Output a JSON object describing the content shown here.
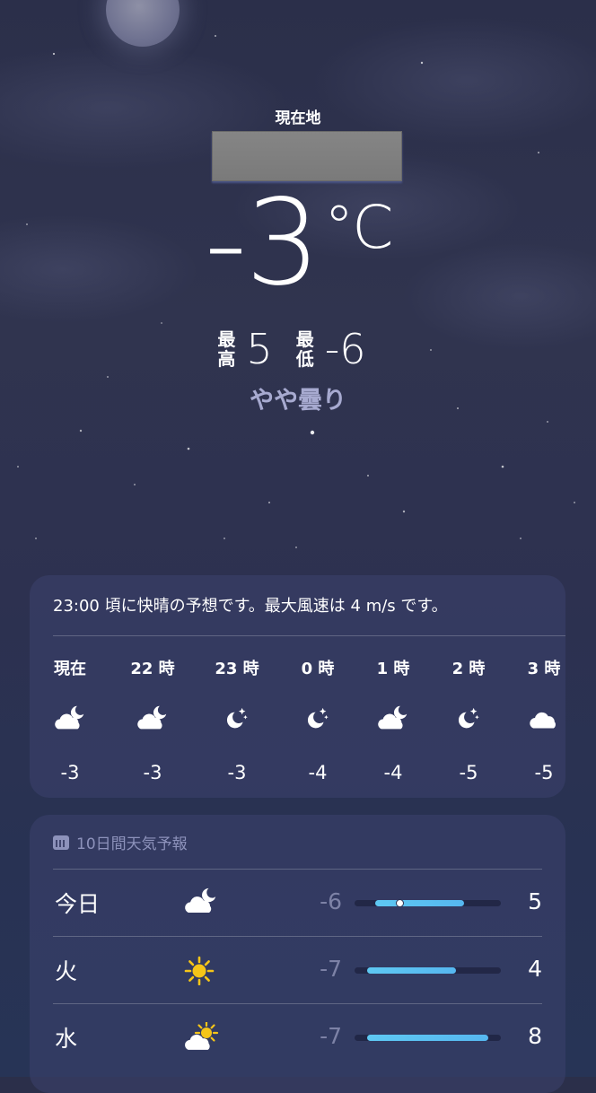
{
  "header": {
    "location_label": "現在地",
    "temperature": "-3",
    "temperature_unit": "°C",
    "high_label": "最高",
    "high_value": "5",
    "low_label": "最低",
    "low_value": "-6",
    "condition": "やや曇り"
  },
  "hourly": {
    "summary": "23:00 頃に快晴の予想です。最大風速は 4 m/s です。",
    "items": [
      {
        "time": "現在",
        "icon": "partly-cloudy-night-icon",
        "temp": "-3"
      },
      {
        "time": "22 時",
        "icon": "partly-cloudy-night-icon",
        "temp": "-3"
      },
      {
        "time": "23 時",
        "icon": "clear-night-icon",
        "temp": "-3"
      },
      {
        "time": "0 時",
        "icon": "clear-night-icon",
        "temp": "-4"
      },
      {
        "time": "1 時",
        "icon": "partly-cloudy-night-icon",
        "temp": "-4"
      },
      {
        "time": "2 時",
        "icon": "clear-night-icon",
        "temp": "-5"
      },
      {
        "time": "3 時",
        "icon": "cloud-icon",
        "temp": "-5"
      }
    ]
  },
  "daily": {
    "header_label": "10日間天気予報",
    "header_icon": "calendar-icon",
    "bar_gradient": [
      "#5ec8f2",
      "#56b7f0"
    ],
    "range_min": -7,
    "range_max": 8,
    "days": [
      {
        "name": "今日",
        "icon": "partly-cloudy-night-icon",
        "low": "-6",
        "high": "5",
        "low_num": -6,
        "high_num": 5,
        "current": -3
      },
      {
        "name": "火",
        "icon": "sun-icon",
        "low": "-7",
        "high": "4",
        "low_num": -7,
        "high_num": 4
      },
      {
        "name": "水",
        "icon": "partly-sunny-icon",
        "low": "-7",
        "high": "8",
        "low_num": -7,
        "high_num": 8
      }
    ]
  }
}
